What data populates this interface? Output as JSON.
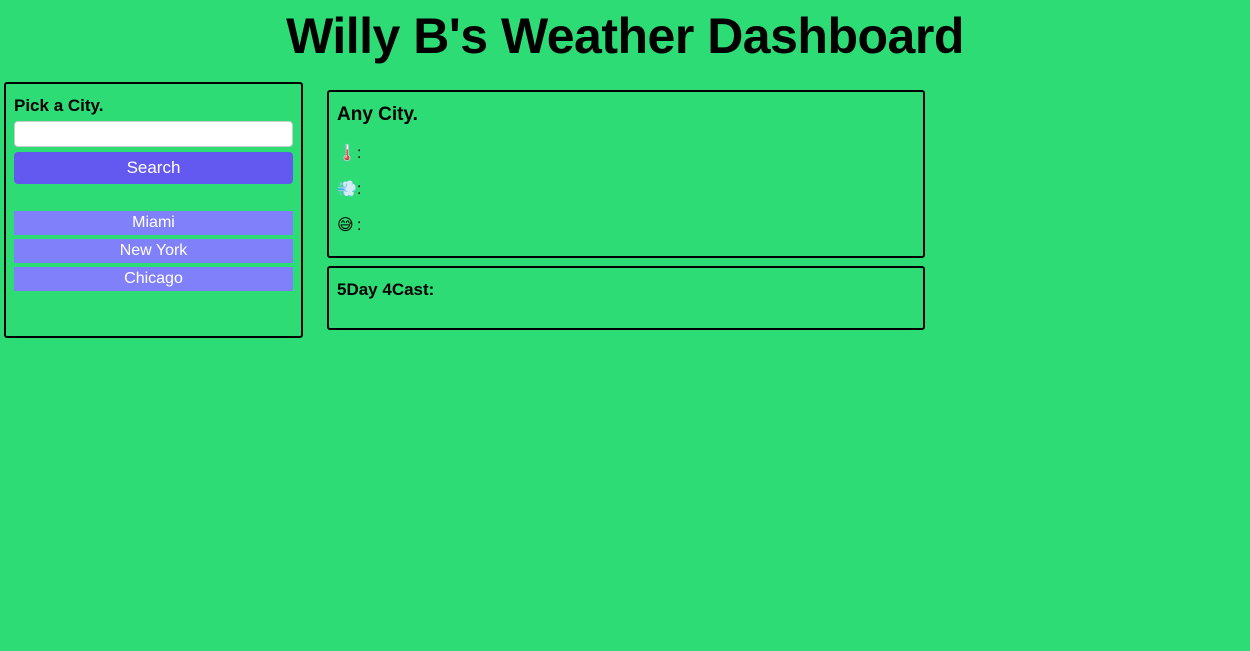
{
  "header": {
    "title": "Willy B's Weather Dashboard"
  },
  "search": {
    "heading": "Pick a City.",
    "input_value": "",
    "placeholder": "",
    "button_label": "Search",
    "history": [
      {
        "label": "Miami"
      },
      {
        "label": "New York"
      },
      {
        "label": "Chicago"
      }
    ]
  },
  "current": {
    "city": "Any City.",
    "stats": [
      {
        "icon": "thermometer-icon",
        "glyph": "🌡️",
        "label": ":"
      },
      {
        "icon": "wind-icon",
        "glyph": "💨",
        "label": ":"
      },
      {
        "icon": "sweat-smile-icon",
        "glyph": "😅",
        "label": ":"
      }
    ]
  },
  "forecast": {
    "heading": "5Day 4Cast:"
  },
  "colors": {
    "background": "#2edc75",
    "search_button": "#6358ef",
    "city_button": "#8180fb"
  }
}
